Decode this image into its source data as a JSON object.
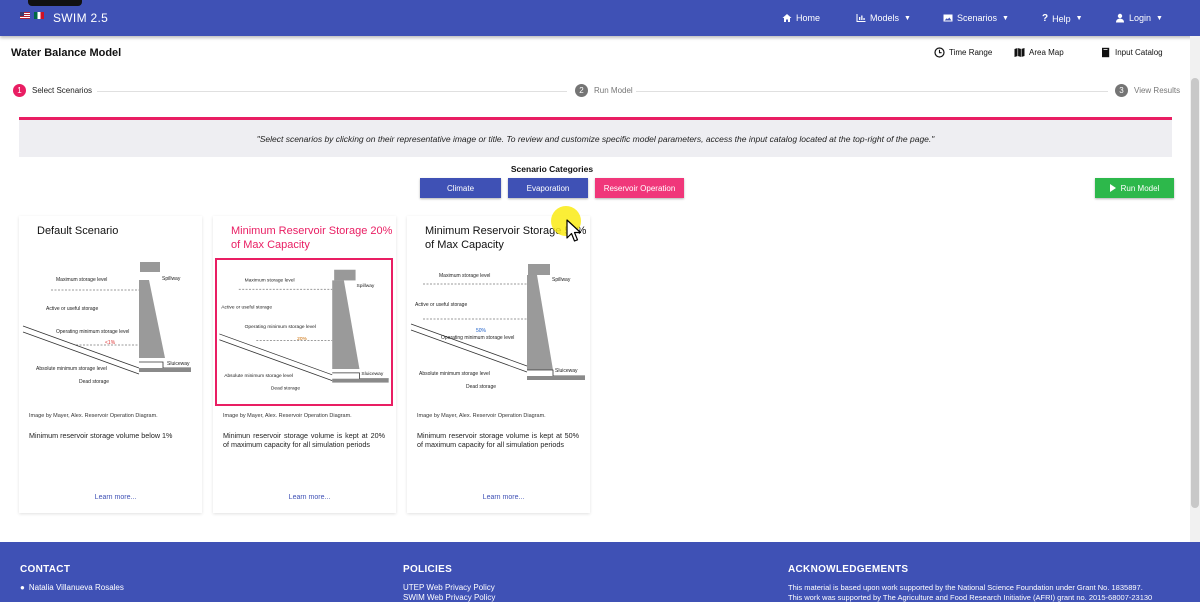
{
  "navbar": {
    "brand": "SWIM 2.5",
    "items": [
      {
        "label": "Home",
        "icon": "home-icon"
      },
      {
        "label": "Models",
        "icon": "chart-icon"
      },
      {
        "label": "Scenarios",
        "icon": "image-icon"
      },
      {
        "label": "Help",
        "icon": "question-icon"
      },
      {
        "label": "Login",
        "icon": "user-icon"
      }
    ],
    "accent": "#3f51b5"
  },
  "header": {
    "title": "Water Balance Model",
    "tools": [
      {
        "label": "Time Range",
        "icon": "clock-icon"
      },
      {
        "label": "Area Map",
        "icon": "map-icon"
      },
      {
        "label": "Input Catalog",
        "icon": "book-icon"
      }
    ]
  },
  "stepper": [
    {
      "number": "1",
      "label": "Select Scenarios"
    },
    {
      "number": "2",
      "label": "Run Model"
    },
    {
      "number": "3",
      "label": "View Results"
    }
  ],
  "banner": {
    "text": "\"Select scenarios by clicking on their representative image or title. To review and customize specific model parameters, access the input catalog located at the top-right of the page.\""
  },
  "categories": {
    "title": "Scenario Categories",
    "buttons": [
      {
        "label": "Climate",
        "color": "#3f51b5"
      },
      {
        "label": "Evaporation",
        "color": "#3f51b5"
      },
      {
        "label": "Reservoir Operation",
        "color": "#f0377a"
      }
    ],
    "run_label": "Run Model"
  },
  "cards": [
    {
      "title": "Default Scenario",
      "diagram": {
        "max_level": "Maximum storage level",
        "active": "Active or useful storage",
        "operating": "Operating minimum storage level",
        "value": "<1%",
        "spillway": "Spillway",
        "absolute": "Absolute minimum storage level",
        "dead": "Dead storage",
        "sluiceway": "Sluiceway"
      },
      "credit": "Image by Mayer, Alex. Reservoir Operation Diagram.",
      "description": "Minimum reservoir storage volume below 1%",
      "learn_more": "Learn more..."
    },
    {
      "title": "Minimum Reservoir Storage 20% of Max Capacity",
      "diagram": {
        "max_level": "Maximum storage level",
        "active": "Active or useful storage",
        "operating": "Operating minimum storage level",
        "value": "20%",
        "spillway": "Spillway",
        "absolute": "Absolute minimum storage level",
        "dead": "Dead storage",
        "sluiceway": "Sluiceway"
      },
      "credit": "Image by Mayer, Alex. Reservoir Operation Diagram.",
      "description": "Minimun reservoir storage volume is kept at 20% of maximum capacity for all simulation periods",
      "learn_more": "Learn more..."
    },
    {
      "title": "Minimum Reservoir Storage 50% of Max Capacity",
      "diagram": {
        "max_level": "Maximum storage level",
        "active": "Active or useful storage",
        "operating": "Operating minimum storage level",
        "value": "50%",
        "spillway": "Spillway",
        "absolute": "Absolute minimum storage level",
        "dead": "Dead storage",
        "sluiceway": "Sluiceway"
      },
      "credit": "Image by Mayer, Alex. Reservoir Operation Diagram.",
      "description": "Minimum reservoir storage volume is kept at 50% of maximum capacity for all simulation periods",
      "learn_more": "Learn more..."
    }
  ],
  "footer": {
    "contact": {
      "heading": "CONTACT",
      "name": "Natalia Villanueva Rosales"
    },
    "policies": {
      "heading": "POLICIES",
      "links": [
        "UTEP Web Privacy Policy",
        "SWIM Web Privacy Policy"
      ]
    },
    "acknowledgements": {
      "heading": "ACKNOWLEDGEMENTS",
      "lines": [
        "This material is based upon work supported by the National Science Foundation under Grant No. 1835897.",
        "This work was supported by The Agriculture and Food Research Initiative (AFRI) grant no. 2015-68007-23130"
      ]
    }
  }
}
